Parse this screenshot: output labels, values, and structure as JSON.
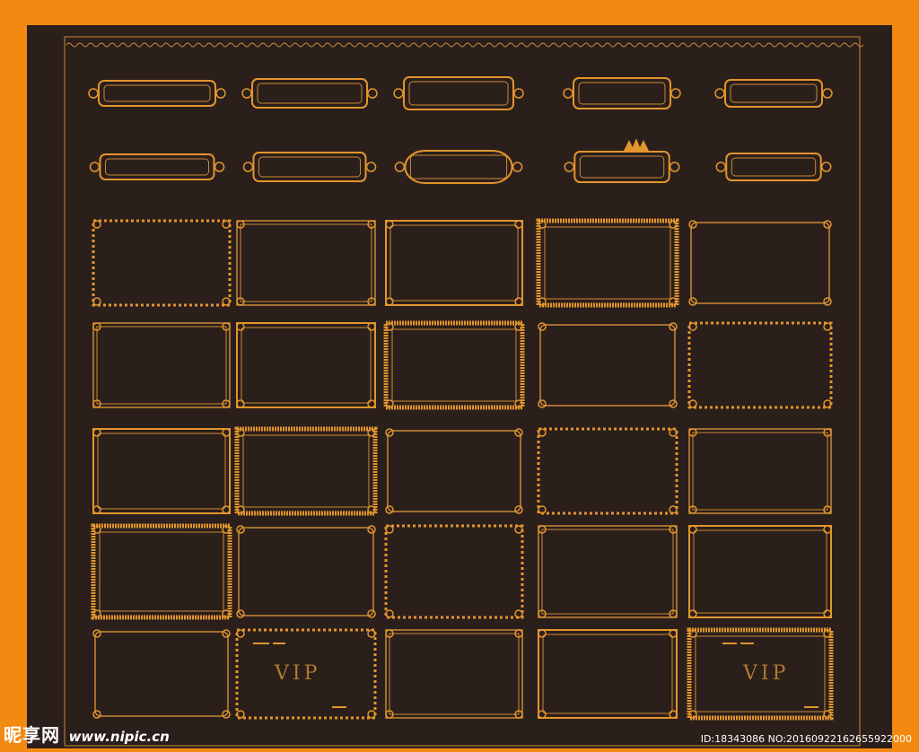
{
  "colors": {
    "background": "#f28a12",
    "board": "#2b1f1b",
    "frame": "#c98a35",
    "frame_bright": "#e2952c"
  },
  "vip_cards": [
    "VIP",
    "VIP"
  ],
  "watermark": {
    "site_name": "昵享网",
    "url": "www.nipic.cn",
    "id_line": "ID:18343086 NO:20160922162655922000"
  },
  "icons": {
    "frames": "ornamental-frame-icon"
  }
}
